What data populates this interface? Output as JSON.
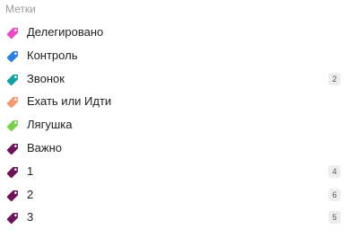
{
  "header": {
    "title": "Метки"
  },
  "tags": [
    {
      "label": "Делегировано",
      "color": "#e84bc3",
      "count": "",
      "icon": "tag-icon"
    },
    {
      "label": "Контроль",
      "color": "#2f7fe0",
      "count": "",
      "icon": "tag-icon"
    },
    {
      "label": "Звонок",
      "color": "#16a0a0",
      "count": "2",
      "icon": "tag-icon"
    },
    {
      "label": "Ехать или Идти",
      "color": "#f29a78",
      "count": "",
      "icon": "tag-icon"
    },
    {
      "label": "Лягушка",
      "color": "#7ccf55",
      "count": "",
      "icon": "tag-icon"
    },
    {
      "label": "Важно",
      "color": "#6b1457",
      "count": "",
      "icon": "tag-icon"
    },
    {
      "label": "1",
      "color": "#6b1457",
      "count": "4",
      "icon": "tag-icon"
    },
    {
      "label": "2",
      "color": "#6b1457",
      "count": "6",
      "icon": "tag-icon"
    },
    {
      "label": "3",
      "color": "#6b1457",
      "count": "5",
      "icon": "tag-icon"
    }
  ]
}
